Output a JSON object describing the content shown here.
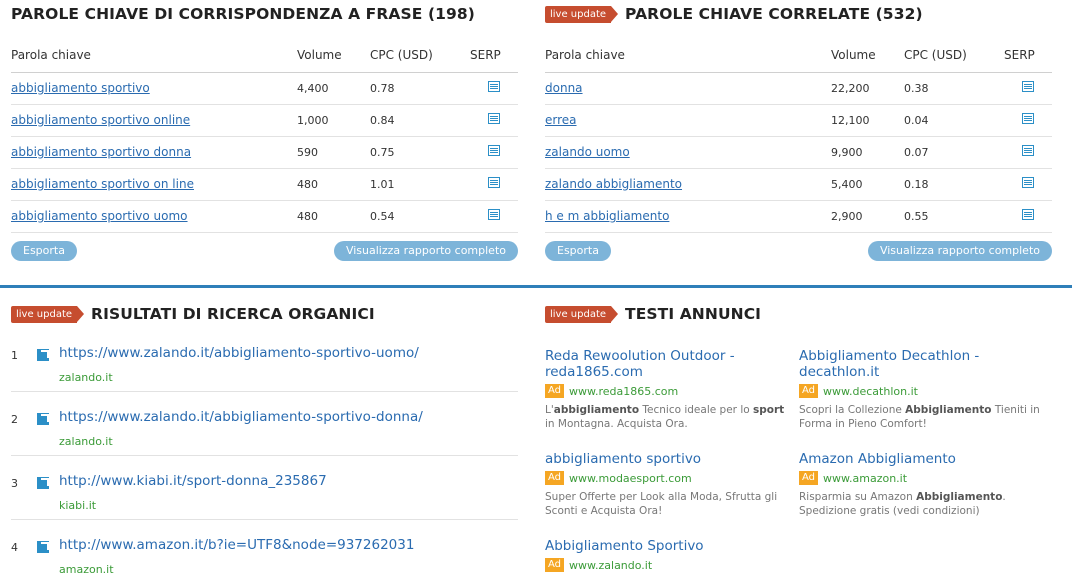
{
  "phrase_match": {
    "title": "PAROLE CHIAVE DI CORRISPONDENZA A FRASE (198)",
    "columns": [
      "Parola chiave",
      "Volume",
      "CPC (USD)",
      "SERP"
    ],
    "rows": [
      {
        "keyword": "abbigliamento sportivo",
        "volume": "4,400",
        "cpc": "0.78"
      },
      {
        "keyword": "abbigliamento sportivo online",
        "volume": "1,000",
        "cpc": "0.84"
      },
      {
        "keyword": "abbigliamento sportivo donna",
        "volume": "590",
        "cpc": "0.75"
      },
      {
        "keyword": "abbigliamento sportivo on line",
        "volume": "480",
        "cpc": "1.01"
      },
      {
        "keyword": "abbigliamento sportivo uomo",
        "volume": "480",
        "cpc": "0.54"
      }
    ],
    "export_label": "Esporta",
    "report_label": "Visualizza rapporto completo"
  },
  "related": {
    "badge": "live update",
    "title": "PAROLE CHIAVE CORRELATE (532)",
    "columns": [
      "Parola chiave",
      "Volume",
      "CPC (USD)",
      "SERP"
    ],
    "rows": [
      {
        "keyword": "donna",
        "volume": "22,200",
        "cpc": "0.38"
      },
      {
        "keyword": "errea",
        "volume": "12,100",
        "cpc": "0.04"
      },
      {
        "keyword": "zalando uomo",
        "volume": "9,900",
        "cpc": "0.07"
      },
      {
        "keyword": "zalando abbigliamento",
        "volume": "5,400",
        "cpc": "0.18"
      },
      {
        "keyword": "h e m abbigliamento",
        "volume": "2,900",
        "cpc": "0.55"
      }
    ],
    "export_label": "Esporta",
    "report_label": "Visualizza rapporto completo"
  },
  "organic": {
    "badge": "live update",
    "title": "RISULTATI DI RICERCA ORGANICI",
    "results": [
      {
        "num": "1",
        "url": "https://www.zalando.it/abbigliamento-sportivo-uomo/",
        "domain": "zalando.it"
      },
      {
        "num": "2",
        "url": "https://www.zalando.it/abbigliamento-sportivo-donna/",
        "domain": "zalando.it"
      },
      {
        "num": "3",
        "url": "http://www.kiabi.it/sport-donna_235867",
        "domain": "kiabi.it"
      },
      {
        "num": "4",
        "url": "http://www.amazon.it/b?ie=UTF8&node=937262031",
        "domain": "amazon.it"
      }
    ]
  },
  "ads": {
    "badge": "live update",
    "title": "TESTI ANNUNCI",
    "ad_label": "Ad",
    "items": [
      {
        "title": "Reda Rewoolution Outdoor - reda1865.com",
        "url": "www.reda1865.com",
        "desc_pre": "L'",
        "desc_b1": "abbigliamento",
        "desc_mid": " Tecnico ideale per lo ",
        "desc_b2": "sport",
        "desc_post": " in Montagna. Acquista Ora."
      },
      {
        "title": "Abbigliamento Decathlon - decathlon.it",
        "url": "www.decathlon.it",
        "desc_pre": "Scopri la Collezione ",
        "desc_b1": "Abbigliamento",
        "desc_mid": " Tieniti in Forma in Pieno Comfort!",
        "desc_b2": "",
        "desc_post": ""
      },
      {
        "title": "abbigliamento sportivo",
        "url": "www.modaesport.com",
        "desc_pre": "Super Offerte per Look alla Moda, Sfrutta gli Sconti e Acquista Ora!",
        "desc_b1": "",
        "desc_mid": "",
        "desc_b2": "",
        "desc_post": ""
      },
      {
        "title": "Amazon Abbigliamento",
        "url": "www.amazon.it",
        "desc_pre": "Risparmia su Amazon ",
        "desc_b1": "Abbigliamento",
        "desc_mid": ". Spedizione gratis (vedi condizioni)",
        "desc_b2": "",
        "desc_post": ""
      },
      {
        "title": "Abbigliamento Sportivo",
        "url": "www.zalando.it",
        "desc_pre": "",
        "desc_b1": "",
        "desc_mid": "",
        "desc_b2": "",
        "desc_post": ""
      }
    ]
  },
  "colors": {
    "accent_blue": "#2f7fb9",
    "live_badge": "#c64d2f",
    "ad_badge": "#f5a623",
    "domain_green": "#3b9b38",
    "link": "#2a6bb0"
  }
}
